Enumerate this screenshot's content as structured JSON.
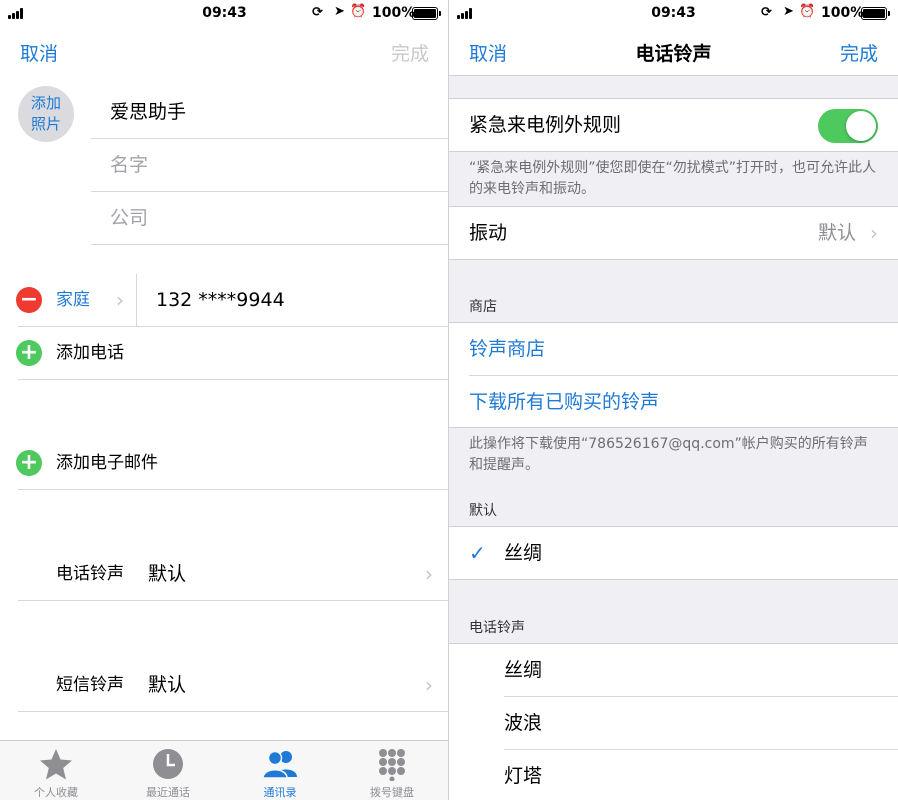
{
  "status": {
    "time": "09:43",
    "battery": "100%"
  },
  "left": {
    "nav": {
      "cancel": "取消",
      "done": "完成"
    },
    "avatar": {
      "line1": "添加",
      "line2": "照片"
    },
    "fields": {
      "last_name": "爱思助手",
      "first_name_placeholder": "名字",
      "company_placeholder": "公司"
    },
    "phone": {
      "label": "家庭",
      "number": "132 ****9944"
    },
    "add_phone": "添加电话",
    "add_email": "添加电子邮件",
    "ringtone": {
      "label": "电话铃声",
      "value": "默认"
    },
    "texttone": {
      "label": "短信铃声",
      "value": "默认"
    },
    "tabs": [
      {
        "label": "个人收藏",
        "icon": "star-icon"
      },
      {
        "label": "最近通话",
        "icon": "clock-icon"
      },
      {
        "label": "通讯录",
        "icon": "contacts-icon"
      },
      {
        "label": "拨号键盘",
        "icon": "keypad-icon"
      }
    ]
  },
  "right": {
    "nav": {
      "cancel": "取消",
      "title": "电话铃声",
      "done": "完成"
    },
    "emergency": {
      "label": "紧急来电例外规则",
      "on": true,
      "note": "“紧急来电例外规则”使您即使在“勿扰模式”打开时，也可允许此人的来电铃声和振动。"
    },
    "vibration": {
      "label": "振动",
      "value": "默认"
    },
    "store_header": "商店",
    "store_items": [
      "铃声商店",
      "下载所有已购买的铃声"
    ],
    "store_note": "此操作将下载使用“786526167@qq.com”帐户购买的所有铃声和提醒声。",
    "default_header": "默认",
    "default_item": "丝绸",
    "ringtones_header": "电话铃声",
    "ringtones": [
      "丝绸",
      "波浪",
      "灯塔"
    ]
  },
  "colors": {
    "accent": "#1f7ad6",
    "toggle_on": "#4dc95e",
    "delete_red": "#ee3a30"
  }
}
